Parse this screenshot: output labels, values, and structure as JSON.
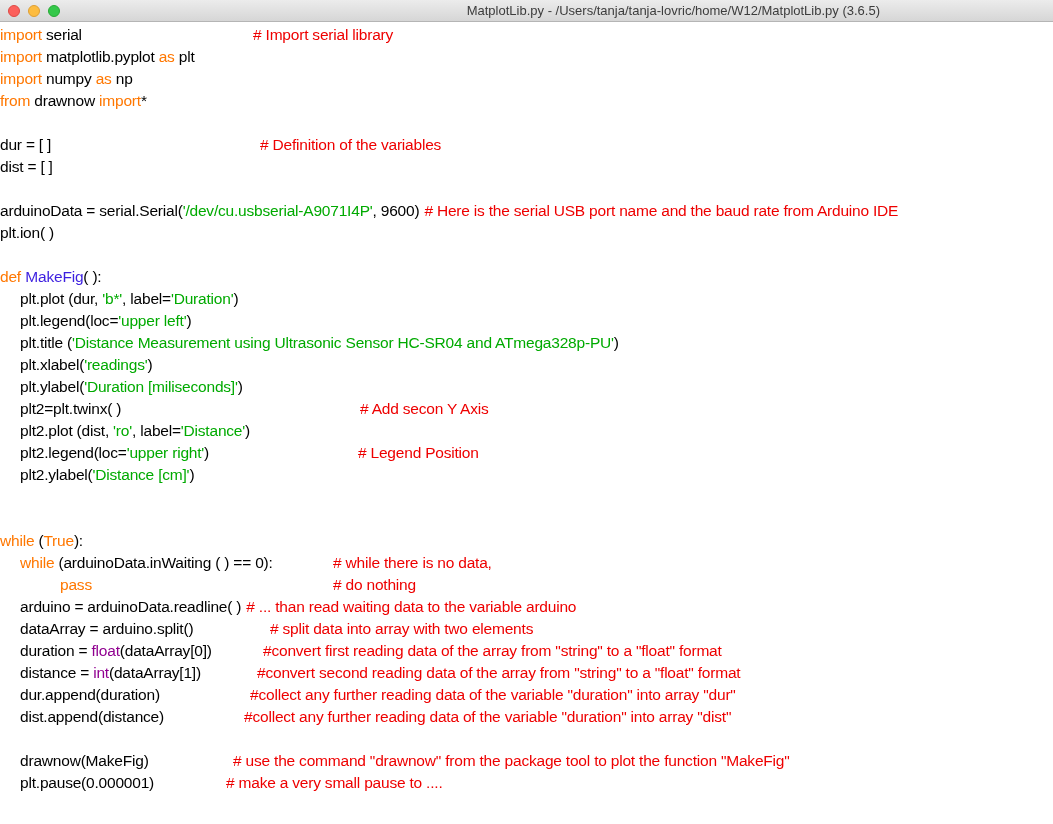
{
  "window": {
    "title": "MatplotLib.py - /Users/tanja/tanja-lovric/home/W12/MatplotLib.py (3.6.5)"
  },
  "code": [
    {
      "kind": "line",
      "segments": [
        {
          "kind": "keyword",
          "text": "import"
        },
        {
          "kind": "plain",
          "text": " serial"
        }
      ],
      "comment": "# Import serial library"
    },
    {
      "kind": "line",
      "segments": [
        {
          "kind": "keyword",
          "text": "import"
        },
        {
          "kind": "plain",
          "text": " matplotlib.pyplot "
        },
        {
          "kind": "keyword",
          "text": "as"
        },
        {
          "kind": "plain",
          "text": " plt"
        }
      ]
    },
    {
      "kind": "line",
      "segments": [
        {
          "kind": "keyword",
          "text": "import"
        },
        {
          "kind": "plain",
          "text": " numpy "
        },
        {
          "kind": "keyword",
          "text": "as"
        },
        {
          "kind": "plain",
          "text": " np"
        }
      ]
    },
    {
      "kind": "line",
      "segments": [
        {
          "kind": "keyword",
          "text": "from"
        },
        {
          "kind": "plain",
          "text": " drawnow "
        },
        {
          "kind": "keyword",
          "text": "import"
        },
        {
          "kind": "plain",
          "text": "*"
        }
      ]
    },
    {
      "kind": "blank"
    },
    {
      "kind": "line",
      "segments": [
        {
          "kind": "plain",
          "text": "dur = [ ]"
        }
      ],
      "comment": "# Definition of the variables"
    },
    {
      "kind": "line",
      "segments": [
        {
          "kind": "plain",
          "text": "dist = [ ]"
        }
      ]
    },
    {
      "kind": "blank"
    },
    {
      "kind": "line",
      "segments": [
        {
          "kind": "plain",
          "text": "arduinoData = serial.Serial("
        },
        {
          "kind": "string",
          "text": "'/dev/cu.usbserial-A9071I4P'"
        },
        {
          "kind": "plain",
          "text": ", 9600)"
        }
      ],
      "comment": "# Here is the serial USB port name and the baud rate from Arduino IDE"
    },
    {
      "kind": "line",
      "segments": [
        {
          "kind": "plain",
          "text": "plt.ion( )"
        }
      ]
    },
    {
      "kind": "blank"
    },
    {
      "kind": "line",
      "segments": [
        {
          "kind": "keyword",
          "text": "def"
        },
        {
          "kind": "definition",
          "text": "MakeFig"
        },
        {
          "kind": "plain",
          "text": "( ):"
        }
      ],
      "children": [
        {
          "kind": "line",
          "segments": [
            {
              "kind": "plain",
              "text": "plt.plot (dur, "
            },
            {
              "kind": "string",
              "text": "'b*'"
            },
            {
              "kind": "plain",
              "text": ", label="
            },
            {
              "kind": "string",
              "text": "'Duration'"
            },
            {
              "kind": "plain",
              "text": ")"
            }
          ]
        },
        {
          "kind": "line",
          "segments": [
            {
              "kind": "plain",
              "text": "plt.legend(loc="
            },
            {
              "kind": "string",
              "text": "'upper left'"
            },
            {
              "kind": "plain",
              "text": ")"
            }
          ]
        },
        {
          "kind": "line",
          "segments": [
            {
              "kind": "plain",
              "text": "plt.title ("
            },
            {
              "kind": "string",
              "text": "'Distance Measurement using Ultrasonic Sensor HC-SR04 and ATmega328p-PU'"
            },
            {
              "kind": "plain",
              "text": ")"
            }
          ]
        },
        {
          "kind": "line",
          "segments": [
            {
              "kind": "plain",
              "text": "plt.xlabel("
            },
            {
              "kind": "string",
              "text": "'readings'"
            },
            {
              "kind": "plain",
              "text": ")"
            }
          ]
        },
        {
          "kind": "line",
          "segments": [
            {
              "kind": "plain",
              "text": "plt.ylabel("
            },
            {
              "kind": "string",
              "text": "'Duration [miliseconds]'"
            },
            {
              "kind": "plain",
              "text": ")"
            }
          ]
        },
        {
          "kind": "line",
          "segments": [
            {
              "kind": "plain",
              "text": "plt2=plt.twinx( )"
            }
          ],
          "comment": "# Add secon Y Axis"
        },
        {
          "kind": "line",
          "segments": [
            {
              "kind": "plain",
              "text": "plt2.plot (dist, "
            },
            {
              "kind": "string",
              "text": "'ro'"
            },
            {
              "kind": "plain",
              "text": ", label="
            },
            {
              "kind": "string",
              "text": "'Distance'"
            },
            {
              "kind": "plain",
              "text": ")"
            }
          ]
        },
        {
          "kind": "line",
          "segments": [
            {
              "kind": "plain",
              "text": "plt2.legend(loc="
            },
            {
              "kind": "string",
              "text": "'upper right'"
            },
            {
              "kind": "plain",
              "text": ")"
            }
          ],
          "comment": "# Legend Position"
        },
        {
          "kind": "line",
          "segments": [
            {
              "kind": "plain",
              "text": "plt2.ylabel("
            },
            {
              "kind": "string",
              "text": "'Distance [cm]'"
            },
            {
              "kind": "plain",
              "text": ")"
            }
          ]
        }
      ]
    },
    {
      "kind": "blank"
    },
    {
      "kind": "blank"
    },
    {
      "kind": "line",
      "segments": [
        {
          "kind": "keyword",
          "text": "while"
        },
        {
          "kind": "plain",
          "text": " ("
        },
        {
          "kind": "keyword",
          "text": "True"
        },
        {
          "kind": "plain",
          "text": "):"
        }
      ],
      "children": [
        {
          "kind": "line",
          "segments": [
            {
              "kind": "keyword",
              "text": "while"
            },
            {
              "kind": "plain",
              "text": " (arduinoData.inWaiting ( ) == 0):"
            }
          ],
          "comment": "# while there is no data,",
          "children": [
            {
              "kind": "line",
              "segments": [
                {
                  "kind": "keyword",
                  "text": "pass"
                }
              ],
              "comment": "# do nothing"
            }
          ]
        },
        {
          "kind": "line",
          "segments": [
            {
              "kind": "plain",
              "text": "arduino = arduinoData.readline( )"
            }
          ],
          "comment": "# ... than read waiting data to the variable arduino"
        },
        {
          "kind": "line",
          "segments": [
            {
              "kind": "plain",
              "text": "dataArray = arduino.split()"
            }
          ],
          "comment": "# split data into array with two elements"
        },
        {
          "kind": "line",
          "segments": [
            {
              "kind": "plain",
              "text": "duration = "
            },
            {
              "kind": "builtin",
              "text": "float"
            },
            {
              "kind": "plain",
              "text": "(dataArray[0])"
            }
          ],
          "comment": "#convert first reading data of the array from \"string\" to a \"float\" format"
        },
        {
          "kind": "line",
          "segments": [
            {
              "kind": "plain",
              "text": "distance = "
            },
            {
              "kind": "builtin",
              "text": "int"
            },
            {
              "kind": "plain",
              "text": "(dataArray[1])"
            }
          ],
          "comment": "#convert second reading data of the array from \"string\" to a \"float\" format"
        },
        {
          "kind": "line",
          "segments": [
            {
              "kind": "plain",
              "text": "dur.append(duration)"
            }
          ],
          "comment": "#collect any further reading data of the variable \"duration\" into array \"dur\""
        },
        {
          "kind": "line",
          "segments": [
            {
              "kind": "plain",
              "text": "dist.append(distance)"
            }
          ],
          "comment": "#collect any further reading data of the variable \"duration\" into array \"dist\""
        },
        {
          "kind": "blank"
        },
        {
          "kind": "line",
          "segments": [
            {
              "kind": "plain",
              "text": "drawnow(MakeFig)"
            }
          ],
          "comment": "# use the command \"drawnow\" from the package tool to plot the function \"MakeFig\""
        },
        {
          "kind": "line",
          "segments": [
            {
              "kind": "plain",
              "text": "plt.pause(0.000001)"
            }
          ],
          "comment": "# make a very small pause to ...."
        }
      ]
    }
  ]
}
